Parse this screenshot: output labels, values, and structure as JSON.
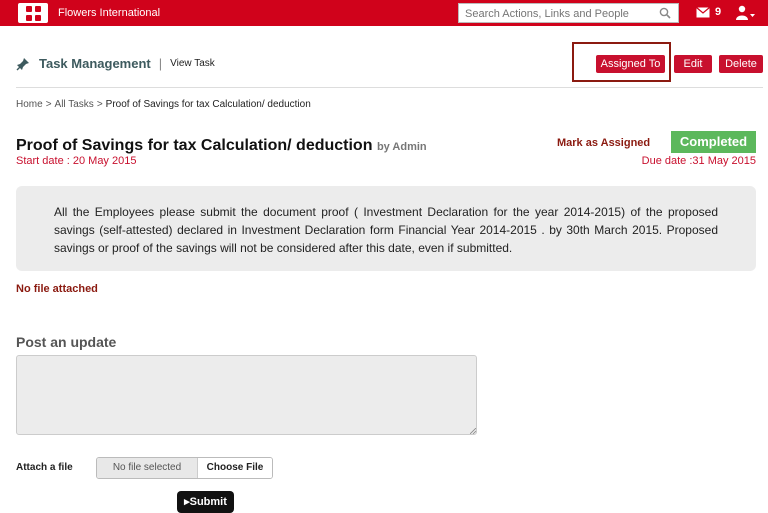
{
  "topbar": {
    "brand": "Flowers International",
    "search_placeholder": "Search Actions, Links and People",
    "mail_count": "9",
    "accent_color": "#d0021b"
  },
  "header": {
    "section_title": "Task Management",
    "separator": "|",
    "view_task": "View Task"
  },
  "actions": {
    "assigned_to": "Assigned To",
    "edit": "Edit",
    "delete": "Delete"
  },
  "breadcrumb": {
    "home": "Home",
    "all_tasks": "All Tasks",
    "current": "Proof of Savings for tax Calculation/ deduction"
  },
  "task": {
    "title": "Proof of Savings for tax Calculation/ deduction",
    "by": "by Admin",
    "start_date": "Start date : 20 May 2015",
    "due_date": "Due date :31 May 2015",
    "mark_assigned": "Mark as Assigned",
    "status": "Completed",
    "description": "All the Employees please submit the document proof ( Investment Declaration for the year 2014-2015) of the proposed savings (self-attested) declared in Investment Declaration form Financial Year 2014-2015 . by 30th March 2015. Proposed savings or proof of the savings will not be considered after this date, even if submitted.",
    "attachment": "No file attached"
  },
  "update": {
    "title": "Post an update",
    "attach_label": "Attach a file",
    "file_status": "No file selected",
    "choose_file": "Choose File",
    "submit": "Submit"
  }
}
